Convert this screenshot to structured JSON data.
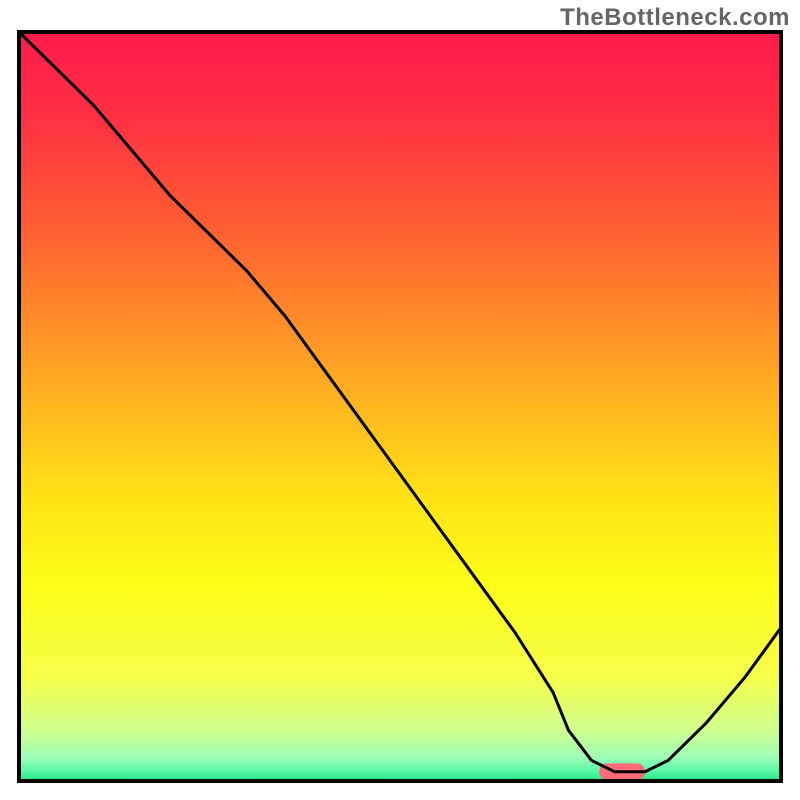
{
  "watermark": "TheBottleneck.com",
  "chart_data": {
    "type": "line",
    "title": "",
    "xlabel": "",
    "ylabel": "",
    "xlim": [
      0,
      100
    ],
    "ylim": [
      0,
      100
    ],
    "axes_visible": false,
    "grid": false,
    "background_gradient": {
      "stops": [
        {
          "offset": 0.0,
          "color": "#ff1a4c"
        },
        {
          "offset": 0.12,
          "color": "#ff3142"
        },
        {
          "offset": 0.25,
          "color": "#ff5a34"
        },
        {
          "offset": 0.38,
          "color": "#ff8a2a"
        },
        {
          "offset": 0.5,
          "color": "#ffb61f"
        },
        {
          "offset": 0.62,
          "color": "#ffe216"
        },
        {
          "offset": 0.74,
          "color": "#fdfe18"
        },
        {
          "offset": 0.86,
          "color": "#f5ff4a"
        },
        {
          "offset": 0.93,
          "color": "#d0ff8f"
        },
        {
          "offset": 0.965,
          "color": "#9fffb6"
        },
        {
          "offset": 0.985,
          "color": "#56f7a5"
        },
        {
          "offset": 1.0,
          "color": "#18e07a"
        }
      ]
    },
    "series": [
      {
        "name": "bottleneck-curve",
        "color": "#000000",
        "width": 3,
        "x": [
          0,
          5,
          10,
          15,
          20,
          25,
          30,
          35,
          40,
          45,
          50,
          55,
          60,
          65,
          70,
          72,
          75,
          78,
          80,
          82,
          85,
          90,
          95,
          100
        ],
        "y": [
          100,
          95,
          90,
          84,
          78,
          73,
          68,
          62,
          55,
          48,
          41,
          34,
          27,
          20,
          12,
          7,
          3,
          1.5,
          1.5,
          1.5,
          3,
          8,
          14,
          21
        ]
      }
    ],
    "markers": [
      {
        "name": "optimal-region",
        "shape": "rounded-bar",
        "x_start": 76,
        "x_end": 82,
        "y": 1.5,
        "height": 2.2,
        "color": "#ff6b78"
      }
    ],
    "frame": {
      "stroke": "#000000",
      "width": 4
    }
  }
}
